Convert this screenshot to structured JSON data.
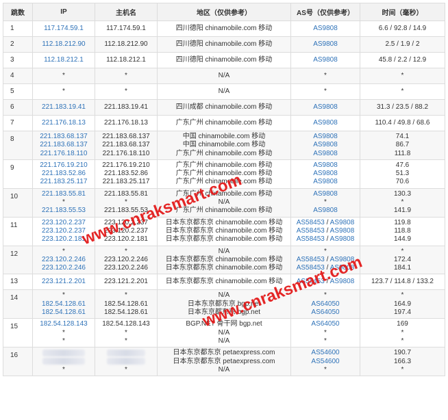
{
  "headers": [
    "跳数",
    "IP",
    "主机名",
    "地区（仅供参考）",
    "AS号（仅供参考）",
    "时间（毫秒）"
  ],
  "watermark": "www.cnraksmart.com",
  "colors": {
    "link": "#2e72b8",
    "watermark": "#e31b1b",
    "header_bg": "#f2f2f2",
    "border": "#dcdcdc"
  },
  "rows": [
    {
      "hop": "1",
      "lines": [
        {
          "ip": "117.174.59.1",
          "host": "117.174.59.1",
          "region": "四川德阳 chinamobile.com 移动",
          "as": [
            "AS9808"
          ],
          "time": "6.6 / 92.8 / 14.9"
        }
      ]
    },
    {
      "hop": "2",
      "lines": [
        {
          "ip": "112.18.212.90",
          "host": "112.18.212.90",
          "region": "四川德阳 chinamobile.com 移动",
          "as": [
            "AS9808"
          ],
          "time": "2.5 / 1.9 / 2"
        }
      ]
    },
    {
      "hop": "3",
      "lines": [
        {
          "ip": "112.18.212.1",
          "host": "112.18.212.1",
          "region": "四川德阳 chinamobile.com 移动",
          "as": [
            "AS9808"
          ],
          "time": "45.8 / 2.2 / 12.9"
        }
      ]
    },
    {
      "hop": "4",
      "lines": [
        {
          "ip": "*",
          "host": "*",
          "region": "N/A",
          "as": [
            "*"
          ],
          "time": "*"
        }
      ]
    },
    {
      "hop": "5",
      "lines": [
        {
          "ip": "*",
          "host": "*",
          "region": "N/A",
          "as": [
            "*"
          ],
          "time": "*"
        }
      ]
    },
    {
      "hop": "6",
      "lines": [
        {
          "ip": "221.183.19.41",
          "host": "221.183.19.41",
          "region": "四川成都 chinamobile.com 移动",
          "as": [
            "AS9808"
          ],
          "time": "31.3 / 23.5 / 88.2"
        }
      ]
    },
    {
      "hop": "7",
      "lines": [
        {
          "ip": "221.176.18.13",
          "host": "221.176.18.13",
          "region": "广东广州 chinamobile.com 移动",
          "as": [
            "AS9808"
          ],
          "time": "110.4 / 49.8 / 68.6"
        }
      ]
    },
    {
      "hop": "8",
      "lines": [
        {
          "ip": "221.183.68.137",
          "host": "221.183.68.137",
          "region": "中国 chinamobile.com 移动",
          "as": [
            "AS9808"
          ],
          "time": "74.1"
        },
        {
          "ip": "221.183.68.137",
          "host": "221.183.68.137",
          "region": "中国 chinamobile.com 移动",
          "as": [
            "AS9808"
          ],
          "time": "86.7"
        },
        {
          "ip": "221.176.18.110",
          "host": "221.176.18.110",
          "region": "广东广州 chinamobile.com 移动",
          "as": [
            "AS9808"
          ],
          "time": "111.8"
        }
      ]
    },
    {
      "hop": "9",
      "lines": [
        {
          "ip": "221.176.19.210",
          "host": "221.176.19.210",
          "region": "广东广州 chinamobile.com 移动",
          "as": [
            "AS9808"
          ],
          "time": "47.6"
        },
        {
          "ip": "221.183.52.86",
          "host": "221.183.52.86",
          "region": "广东广州 chinamobile.com 移动",
          "as": [
            "AS9808"
          ],
          "time": "51.3"
        },
        {
          "ip": "221.183.25.117",
          "host": "221.183.25.117",
          "region": "广东广州 chinamobile.com 移动",
          "as": [
            "AS9808"
          ],
          "time": "70.6"
        }
      ]
    },
    {
      "hop": "10",
      "lines": [
        {
          "ip": "221.183.55.81",
          "host": "221.183.55.81",
          "region": "广东广州 chinamobile.com 移动",
          "as": [
            "AS9808"
          ],
          "time": "130.3"
        },
        {
          "ip": "*",
          "host": "*",
          "region": "N/A",
          "as": [
            "*"
          ],
          "time": "*"
        },
        {
          "ip": "221.183.55.53",
          "host": "221.183.55.53",
          "region": "广东广州 chinamobile.com 移动",
          "as": [
            "AS9808"
          ],
          "time": "141.9"
        }
      ]
    },
    {
      "hop": "11",
      "lines": [
        {
          "ip": "223.120.2.237",
          "host": "223.120.2.237",
          "region": "日本东京都东京 chinamobile.com 移动",
          "as": [
            "AS58453",
            "AS9808"
          ],
          "time": "119.8"
        },
        {
          "ip": "223.120.2.237",
          "host": "223.120.2.237",
          "region": "日本东京都东京 chinamobile.com 移动",
          "as": [
            "AS58453",
            "AS9808"
          ],
          "time": "118.8"
        },
        {
          "ip": "223.120.2.181",
          "host": "223.120.2.181",
          "region": "日本东京都东京 chinamobile.com 移动",
          "as": [
            "AS58453",
            "AS9808"
          ],
          "time": "144.9"
        }
      ]
    },
    {
      "hop": "12",
      "lines": [
        {
          "ip": "*",
          "host": "*",
          "region": "N/A",
          "as": [
            "*"
          ],
          "time": "*"
        },
        {
          "ip": "223.120.2.246",
          "host": "223.120.2.246",
          "region": "日本东京都东京 chinamobile.com 移动",
          "as": [
            "AS58453",
            "AS9808"
          ],
          "time": "172.4"
        },
        {
          "ip": "223.120.2.246",
          "host": "223.120.2.246",
          "region": "日本东京都东京 chinamobile.com 移动",
          "as": [
            "AS58453",
            "AS9808"
          ],
          "time": "184.1"
        }
      ]
    },
    {
      "hop": "13",
      "lines": [
        {
          "ip": "223.121.2.201",
          "host": "223.121.2.201",
          "region": "日本东京都东京 chinamobile.com 移动",
          "as": [
            "AS58453",
            "AS9808"
          ],
          "time": "123.7 / 114.8 / 133.2"
        }
      ]
    },
    {
      "hop": "14",
      "lines": [
        {
          "ip": "*",
          "host": "*",
          "region": "N/A",
          "as": [
            "*"
          ],
          "time": "*"
        },
        {
          "ip": "182.54.128.61",
          "host": "182.54.128.61",
          "region": "日本东京都东京 bgp.net",
          "as": [
            "AS64050"
          ],
          "time": "164.9"
        },
        {
          "ip": "182.54.128.61",
          "host": "182.54.128.61",
          "region": "日本东京都东京 bgp.net",
          "as": [
            "AS64050"
          ],
          "time": "197.4"
        }
      ]
    },
    {
      "hop": "15",
      "lines": [
        {
          "ip": "182.54.128.143",
          "host": "182.54.128.143",
          "region": "BGP.NET 骨干网 bgp.net",
          "as": [
            "AS64050"
          ],
          "time": "169"
        },
        {
          "ip": "*",
          "host": "*",
          "region": "N/A",
          "as": [
            "*"
          ],
          "time": "*"
        },
        {
          "ip": "*",
          "host": "*",
          "region": "N/A",
          "as": [
            "*"
          ],
          "time": "*"
        }
      ]
    },
    {
      "hop": "16",
      "lines": [
        {
          "ip": "",
          "host": "",
          "region": "日本东京都东京 petaexpress.com",
          "as": [
            "AS54600"
          ],
          "time": "190.7"
        },
        {
          "ip": "",
          "host": "",
          "region": "日本东京都东京 petaexpress.com",
          "as": [
            "AS54600"
          ],
          "time": "166.3"
        },
        {
          "ip": "*",
          "host": "*",
          "region": "N/A",
          "as": [
            "*"
          ],
          "time": "*"
        }
      ]
    }
  ]
}
